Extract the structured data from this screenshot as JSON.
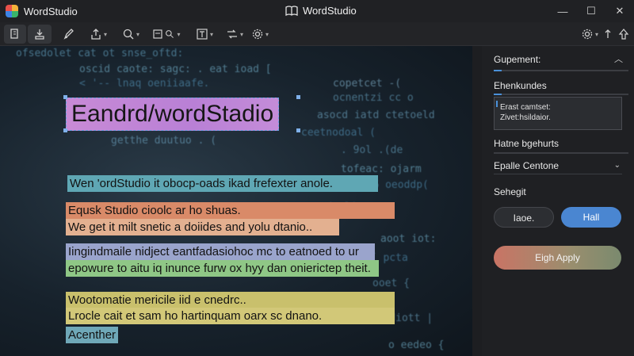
{
  "app": {
    "name": "WordStudio",
    "window_title": "WordStudio",
    "window_controls": {
      "minimize": "—",
      "maximize": "☐",
      "close": "✕"
    }
  },
  "toolbar": {
    "tools": [
      "pages-icon",
      "import-icon",
      "pen-icon",
      "export-icon",
      "zoom-icon",
      "find-icon",
      "font-icon",
      "transform-icon",
      "settings-icon"
    ],
    "right_tools": [
      "gear-icon",
      "sync-icon",
      "upload-icon"
    ]
  },
  "document": {
    "title": "Eandrd/wordStadio",
    "lines": [
      {
        "text": "Wen 'ordStudio it obocp-oads ikad frefexter anole.",
        "color": "#5fa7b4"
      },
      {
        "text": "Equsk Studio cioolc ar ho shuas.",
        "color": "#d98a68"
      },
      {
        "text": "We get it milt snetic a doiides and yolu dtanio..",
        "color": "#e3b090"
      },
      {
        "text": "Iingindmaile nidject eantfadasiohoc mc to eatnoed to ur",
        "color": "#9aa4cc"
      },
      {
        "text": "epowure to aitu iq inunce furw ox hyy dan onierictep theit.",
        "color": "#8fc786"
      },
      {
        "text": "Wootomatie mericile iid e cnedrc..",
        "color": "#c9c06c"
      },
      {
        "text": "Lrocle cait et sam ho hartinquam oarx sc dnano.",
        "color": "#d2c878"
      },
      {
        "text": "Acenther",
        "color": "#6fa8b8"
      }
    ]
  },
  "panel": {
    "section_title": "Gupement:",
    "field1_label": "Ehenkundes",
    "textbox_line1": "Erast camtset:",
    "textbox_line2": "Zivet:hsildaior.",
    "field2_label": "Hatne bgehurts",
    "dropdown_value": "Epalle Centone",
    "segment_label": "Sehegit",
    "btn_left": "Iaoe.",
    "btn_right": "Hall",
    "apply_button": "Eigh Apply"
  },
  "colors": {
    "accent": "#4a86d1",
    "title_highlight": "#c88ad6",
    "panel_bg": "#1f2023"
  }
}
